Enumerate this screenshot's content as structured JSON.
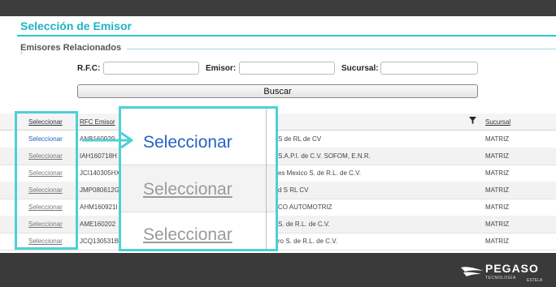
{
  "header": {
    "title": "Selección de Emisor"
  },
  "section": {
    "legend": "Emisores Relacionados",
    "marker": "›"
  },
  "filters": {
    "rfc_label": "R.F.C:",
    "emisor_label": "Emisor:",
    "sucursal_label": "Sucursal:",
    "rfc_value": "",
    "emisor_value": "",
    "sucursal_value": ""
  },
  "search_button": "Buscar",
  "table": {
    "headers": {
      "select": "Seleccionar",
      "rfc": "RFC Emisor",
      "sucursal": "Sucursal"
    },
    "rows": [
      {
        "select": "Seleccionar",
        "rfc": "ANB160929",
        "name": "S de RL de CV",
        "sucursal": "MATRIZ"
      },
      {
        "select": "Seleccionar",
        "rfc": "IAH160718H",
        "name": "S.A.P.I. de C.V. SOFOM, E.N.R.",
        "sucursal": "MATRIZ"
      },
      {
        "select": "Seleccionar",
        "rfc": "JCI140305HX",
        "name": "es Mexico S. de R.L. de C.V.",
        "sucursal": "MATRIZ"
      },
      {
        "select": "Seleccionar",
        "rfc": "JMP080612G",
        "name": "d S RL CV",
        "sucursal": "MATRIZ"
      },
      {
        "select": "Seleccionar",
        "rfc": "AHM160921I",
        "name": "CO AUTOMOTRIZ",
        "sucursal": "MATRIZ"
      },
      {
        "select": "Seleccionar",
        "rfc": "AME160202",
        "name": "S. de R.L. de C.V.",
        "sucursal": "MATRIZ"
      },
      {
        "select": "Seleccionar",
        "rfc": "JCQ130531B",
        "name": "ro S. de R.L. de C.V.",
        "sucursal": "MATRIZ"
      }
    ]
  },
  "zoom": {
    "items": [
      "Seleccionar",
      "Seleccionar",
      "Seleccionar"
    ]
  },
  "brand": {
    "name": "PEGASO",
    "line1": "TECNOLOGÍA",
    "line2": "ESTELA"
  },
  "colors": {
    "accent": "#2ec4d6",
    "link_active": "#2561c8",
    "highlight": "#4fcfd8"
  },
  "icons": {
    "filter": "filter-icon",
    "arrow": "arrow-right-icon",
    "logo": "pegaso-logo-icon"
  }
}
